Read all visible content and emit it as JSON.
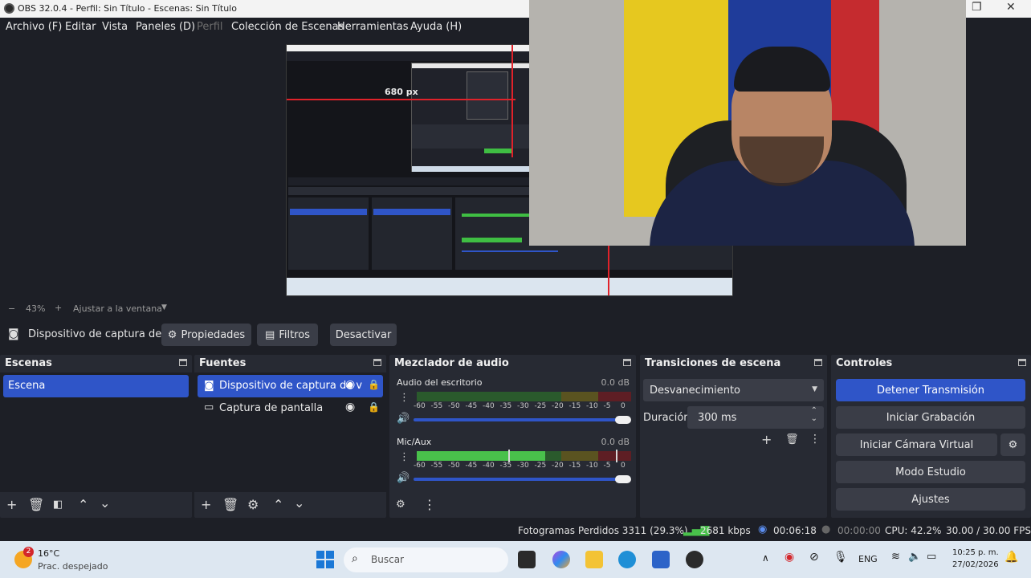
{
  "window": {
    "title": "OBS 32.0.4 - Perfil: Sin Título - Escenas: Sin Título"
  },
  "menu": [
    "Archivo (F)",
    "Editar",
    "Vista",
    "Paneles (D)",
    "Perfil",
    "Colección de Escenas",
    "Herramientas",
    "Ayuda (H)"
  ],
  "nested_capture": {
    "measure_label": "680 px"
  },
  "zoom": {
    "minus": "−",
    "percent": "43%",
    "plus": "+",
    "fit_label": "Ajustar a la ventana"
  },
  "source_toolbar": {
    "source_name": "Dispositivo de captura de v",
    "properties": "Propiedades",
    "filters": "Filtros",
    "deactivate": "Desactivar"
  },
  "scenes": {
    "title": "Escenas",
    "items": [
      "Escena"
    ]
  },
  "sources": {
    "title": "Fuentes",
    "items": [
      "Dispositivo de captura de v",
      "Captura de pantalla"
    ]
  },
  "mixer": {
    "title": "Mezclador de audio",
    "ticks": [
      "-60",
      "-55",
      "-50",
      "-45",
      "-40",
      "-35",
      "-30",
      "-25",
      "-20",
      "-15",
      "-10",
      "-5",
      "0"
    ],
    "channels": [
      {
        "name": "Audio del escritorio",
        "db": "0.0 dB",
        "level": 0.0,
        "volume": 1.0
      },
      {
        "name": "Mic/Aux",
        "db": "0.0 dB",
        "level": 0.6,
        "volume": 1.0
      }
    ]
  },
  "transitions": {
    "title": "Transiciones de escena",
    "selected": "Desvanecimiento",
    "duration_label": "Duración",
    "duration_value": "300 ms"
  },
  "controls": {
    "title": "Controles",
    "stop_stream": "Detener Transmisión",
    "start_record": "Iniciar Grabación",
    "start_virtual_cam": "Iniciar Cámara Virtual",
    "studio_mode": "Modo Estudio",
    "settings": "Ajustes"
  },
  "status": {
    "dropped_frames": "Fotogramas Perdidos 3311 (29.3%)",
    "bitrate": "2681 kbps",
    "stream_time": "00:06:18",
    "record_time": "00:00:00",
    "cpu": "CPU: 42.2%",
    "fps": "30.00 / 30.00 FPS"
  },
  "taskbar": {
    "weather_badge": "2",
    "temperature": "16°C",
    "weather_desc": "Prac. despejado",
    "search_placeholder": "Buscar",
    "lang": "ENG",
    "time": "10:25 p. m.",
    "date": "27/02/2026"
  },
  "colors": {
    "accent": "#2f55c8",
    "panel": "#272a33",
    "background": "#1d1f26",
    "meter_green": "#49c14b",
    "meter_yellow": "#c7b335",
    "meter_red": "#c8303a"
  }
}
